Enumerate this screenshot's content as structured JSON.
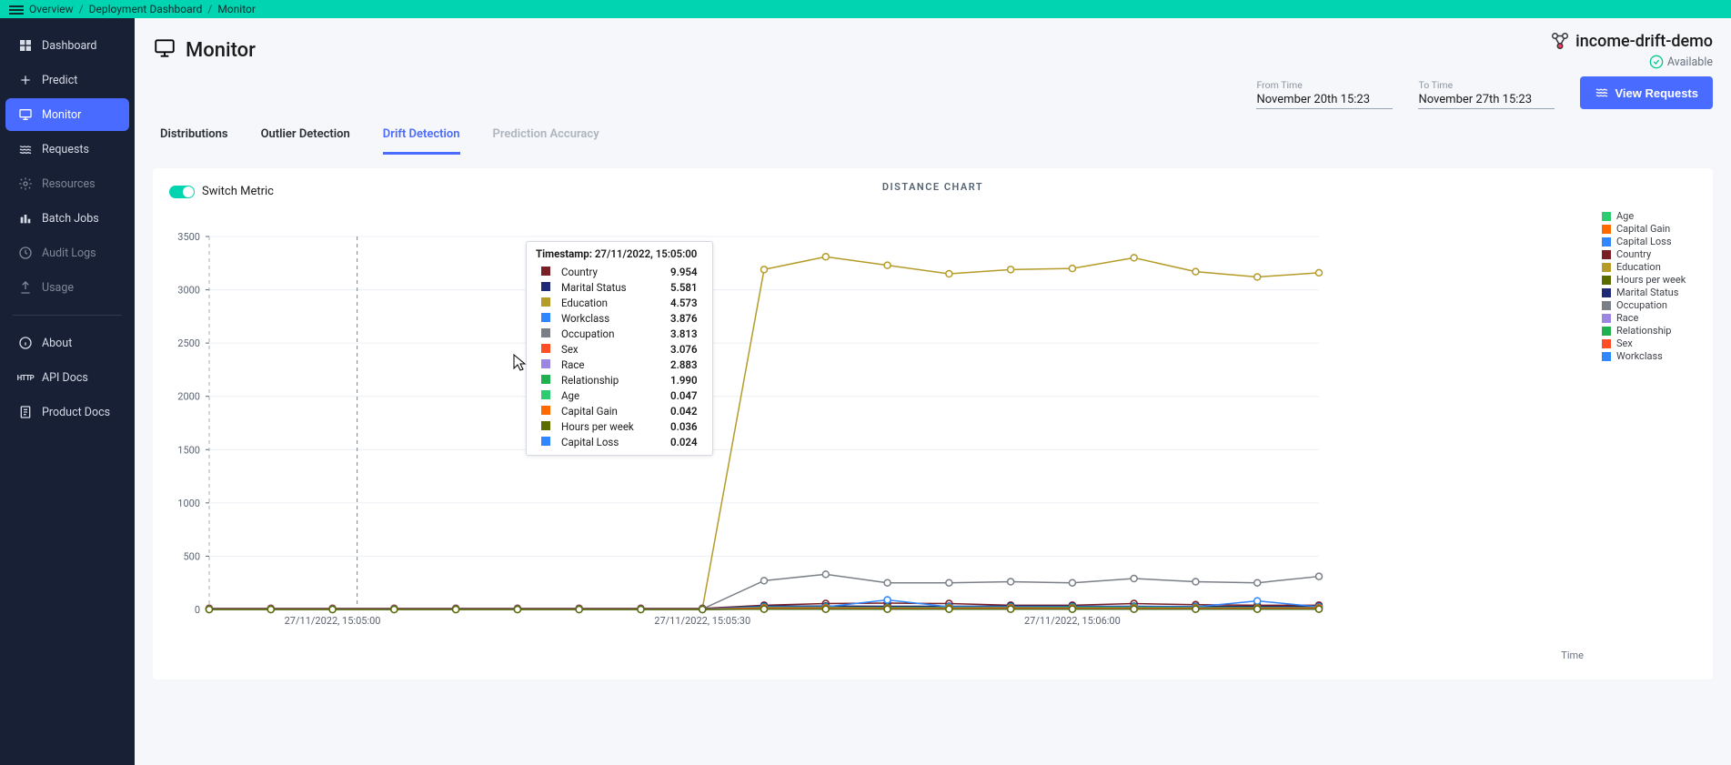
{
  "breadcrumb": [
    "Overview",
    "Deployment Dashboard",
    "Monitor"
  ],
  "sidebar": {
    "items": [
      {
        "label": "Dashboard",
        "icon": "dashboard-icon"
      },
      {
        "label": "Predict",
        "icon": "plus-icon"
      },
      {
        "label": "Monitor",
        "icon": "monitor-icon",
        "active": true
      },
      {
        "label": "Requests",
        "icon": "waves-icon"
      },
      {
        "label": "Resources",
        "icon": "gear-icon",
        "muted": true
      },
      {
        "label": "Batch Jobs",
        "icon": "bars-icon"
      },
      {
        "label": "Audit Logs",
        "icon": "clock-icon",
        "muted": true
      },
      {
        "label": "Usage",
        "icon": "upload-icon",
        "muted": true
      }
    ],
    "secondary": [
      {
        "label": "About",
        "icon": "info-icon"
      },
      {
        "label": "API Docs",
        "icon": "http-icon"
      },
      {
        "label": "Product Docs",
        "icon": "doc-icon"
      }
    ]
  },
  "page": {
    "title": "Monitor",
    "deployment": "income-drift-demo",
    "status": "Available"
  },
  "time": {
    "from_label": "From Time",
    "from_value": "November 20th 15:23",
    "to_label": "To Time",
    "to_value": "November 27th 15:23"
  },
  "view_button": "View Requests",
  "tabs": [
    {
      "label": "Distributions"
    },
    {
      "label": "Outlier Detection"
    },
    {
      "label": "Drift Detection",
      "active": true
    },
    {
      "label": "Prediction Accuracy",
      "muted": true
    }
  ],
  "switch_label": "Switch Metric",
  "chart_data": {
    "type": "line",
    "title": "DISTANCE CHART",
    "xlabel": "Time",
    "ylabel": "",
    "ylim": [
      0,
      3500
    ],
    "y_ticks": [
      0,
      500,
      1000,
      1500,
      2000,
      2500,
      3000,
      3500
    ],
    "x_tick_labels": [
      "27/11/2022, 15:05:00",
      "27/11/2022, 15:05:30",
      "27/11/2022, 15:06:00"
    ],
    "x_tick_positions": [
      2,
      8,
      14
    ],
    "x": [
      0,
      1,
      2,
      3,
      4,
      5,
      6,
      7,
      8,
      9,
      10,
      11,
      12,
      13,
      14,
      15,
      16,
      17,
      18
    ],
    "colors": {
      "Age": "#2ecc71",
      "Capital Gain": "#ff6a00",
      "Capital Loss": "#2f86ff",
      "Country": "#7a1f23",
      "Education": "#b59b28",
      "Hours per week": "#5a6b00",
      "Marital Status": "#1e2a78",
      "Occupation": "#7a7f87",
      "Race": "#9b86e2",
      "Relationship": "#1fb04f",
      "Sex": "#ff4e26",
      "Workclass": "#2f86ff"
    },
    "legend_order": [
      "Age",
      "Capital Gain",
      "Capital Loss",
      "Country",
      "Education",
      "Hours per week",
      "Marital Status",
      "Occupation",
      "Race",
      "Relationship",
      "Sex",
      "Workclass"
    ],
    "series": [
      {
        "name": "Education",
        "values": [
          10,
          10,
          10,
          10,
          10,
          10,
          10,
          10,
          10,
          3190,
          3310,
          3230,
          3150,
          3190,
          3200,
          3300,
          3170,
          3120,
          3160
        ]
      },
      {
        "name": "Occupation",
        "values": [
          4,
          4,
          4,
          4,
          4,
          4,
          4,
          4,
          4,
          270,
          330,
          250,
          250,
          260,
          250,
          290,
          260,
          250,
          310
        ]
      },
      {
        "name": "Country",
        "values": [
          10,
          10,
          10,
          10,
          10,
          10,
          10,
          10,
          10,
          40,
          55,
          60,
          55,
          40,
          40,
          55,
          45,
          40,
          40
        ]
      },
      {
        "name": "Age",
        "values": [
          0,
          0,
          0,
          0,
          0,
          0,
          0,
          0,
          0,
          20,
          20,
          18,
          18,
          20,
          20,
          20,
          18,
          18,
          18
        ]
      },
      {
        "name": "Marital Status",
        "values": [
          6,
          6,
          6,
          6,
          6,
          6,
          6,
          6,
          6,
          32,
          32,
          30,
          30,
          32,
          30,
          30,
          28,
          28,
          28
        ]
      },
      {
        "name": "Workclass",
        "values": [
          4,
          4,
          4,
          4,
          4,
          4,
          4,
          4,
          4,
          25,
          25,
          90,
          25,
          25,
          25,
          25,
          25,
          80,
          25
        ]
      },
      {
        "name": "Race",
        "values": [
          3,
          3,
          3,
          3,
          3,
          3,
          3,
          3,
          3,
          15,
          15,
          14,
          14,
          15,
          14,
          14,
          12,
          12,
          12
        ]
      },
      {
        "name": "Relationship",
        "values": [
          2,
          2,
          2,
          2,
          2,
          2,
          2,
          2,
          2,
          20,
          20,
          18,
          18,
          20,
          20,
          20,
          18,
          18,
          18
        ]
      },
      {
        "name": "Sex",
        "values": [
          3,
          3,
          3,
          3,
          3,
          3,
          3,
          3,
          3,
          14,
          14,
          12,
          12,
          14,
          12,
          12,
          12,
          12,
          14
        ]
      },
      {
        "name": "Capital Gain",
        "values": [
          0,
          0,
          0,
          0,
          0,
          0,
          0,
          0,
          0,
          5,
          5,
          5,
          5,
          5,
          5,
          5,
          5,
          5,
          5
        ]
      },
      {
        "name": "Capital Loss",
        "values": [
          0,
          0,
          0,
          0,
          0,
          0,
          0,
          0,
          0,
          3,
          3,
          3,
          3,
          3,
          3,
          3,
          3,
          3,
          3
        ]
      },
      {
        "name": "Hours per week",
        "values": [
          0,
          0,
          0,
          0,
          0,
          0,
          0,
          0,
          0,
          3,
          3,
          3,
          3,
          3,
          3,
          3,
          3,
          3,
          3
        ]
      }
    ]
  },
  "tooltip": {
    "header_label": "Timestamp:",
    "header_value": "27/11/2022, 15:05:00",
    "rows": [
      {
        "color": "#7a1f23",
        "name": "Country",
        "value": "9.954"
      },
      {
        "color": "#1e2a78",
        "name": "Marital Status",
        "value": "5.581"
      },
      {
        "color": "#b59b28",
        "name": "Education",
        "value": "4.573"
      },
      {
        "color": "#2f86ff",
        "name": "Workclass",
        "value": "3.876"
      },
      {
        "color": "#7a7f87",
        "name": "Occupation",
        "value": "3.813"
      },
      {
        "color": "#ff4e26",
        "name": "Sex",
        "value": "3.076"
      },
      {
        "color": "#9b86e2",
        "name": "Race",
        "value": "2.883"
      },
      {
        "color": "#1fb04f",
        "name": "Relationship",
        "value": "1.990"
      },
      {
        "color": "#2ecc71",
        "name": "Age",
        "value": "0.047"
      },
      {
        "color": "#ff6a00",
        "name": "Capital Gain",
        "value": "0.042"
      },
      {
        "color": "#5a6b00",
        "name": "Hours per week",
        "value": "0.036"
      },
      {
        "color": "#2f86ff",
        "name": "Capital Loss",
        "value": "0.024"
      }
    ]
  }
}
